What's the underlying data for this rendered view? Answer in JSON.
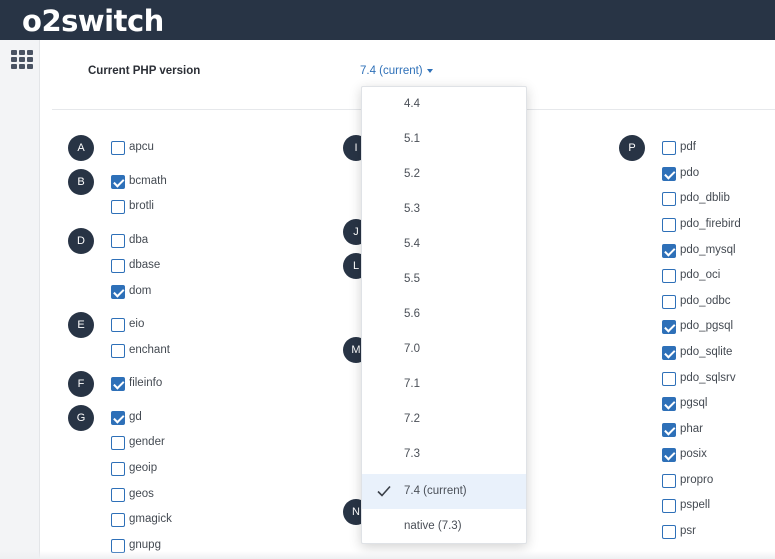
{
  "header": {
    "logo_text_a": "o",
    "logo_text_b": "2",
    "logo_text_c": "switch"
  },
  "php": {
    "label": "Current PHP version",
    "selected": "7.4 (current)"
  },
  "dropdown": {
    "options": [
      "4.4",
      "5.1",
      "5.2",
      "5.3",
      "5.4",
      "5.5",
      "5.6",
      "7.0",
      "7.1",
      "7.2",
      "7.3",
      "7.4 (current)",
      "native (7.3)"
    ],
    "selected_index": 11
  },
  "columns": {
    "left_letters": [
      "A",
      "B",
      "D",
      "E",
      "F",
      "G"
    ],
    "middle_letters": [
      "I",
      "J",
      "L",
      "M",
      "N"
    ],
    "right_letters": [
      "P"
    ],
    "left_extensions": [
      {
        "name": "apcu",
        "checked": false
      },
      {
        "name": "bcmath",
        "checked": true
      },
      {
        "name": "brotli",
        "checked": false
      },
      {
        "name": "dba",
        "checked": false
      },
      {
        "name": "dbase",
        "checked": false
      },
      {
        "name": "dom",
        "checked": true
      },
      {
        "name": "eio",
        "checked": false
      },
      {
        "name": "enchant",
        "checked": false
      },
      {
        "name": "fileinfo",
        "checked": true
      },
      {
        "name": "gd",
        "checked": true
      },
      {
        "name": "gender",
        "checked": false
      },
      {
        "name": "geoip",
        "checked": false
      },
      {
        "name": "geos",
        "checked": false
      },
      {
        "name": "gmagick",
        "checked": false
      },
      {
        "name": "gnupg",
        "checked": false
      }
    ],
    "right_extensions": [
      {
        "name": "pdf",
        "checked": false
      },
      {
        "name": "pdo",
        "checked": true
      },
      {
        "name": "pdo_dblib",
        "checked": false
      },
      {
        "name": "pdo_firebird",
        "checked": false
      },
      {
        "name": "pdo_mysql",
        "checked": true
      },
      {
        "name": "pdo_oci",
        "checked": false
      },
      {
        "name": "pdo_odbc",
        "checked": false
      },
      {
        "name": "pdo_pgsql",
        "checked": true
      },
      {
        "name": "pdo_sqlite",
        "checked": true
      },
      {
        "name": "pdo_sqlsrv",
        "checked": false
      },
      {
        "name": "pgsql",
        "checked": true
      },
      {
        "name": "phar",
        "checked": true
      },
      {
        "name": "posix",
        "checked": true
      },
      {
        "name": "propro",
        "checked": false
      },
      {
        "name": "pspell",
        "checked": false
      },
      {
        "name": "psr",
        "checked": false
      }
    ]
  },
  "colors": {
    "header_bg": "#283445",
    "accent": "#2e70b8",
    "selected_bg": "#e9f1fb"
  },
  "icons": {
    "menu": "grid-icon",
    "selected_option": "check-icon"
  }
}
